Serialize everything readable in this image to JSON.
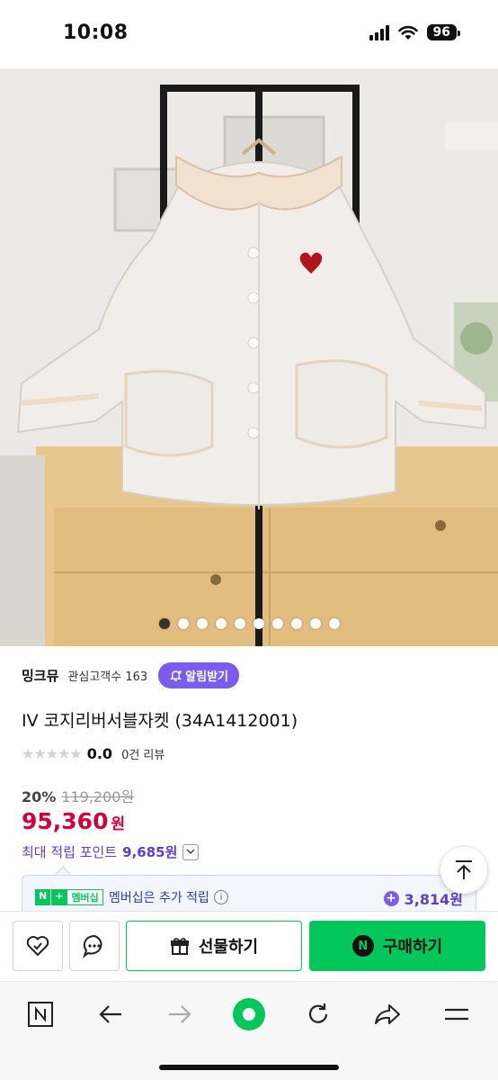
{
  "status_bar": {
    "time": "10:08",
    "battery": "96"
  },
  "gallery": {
    "dots": [
      true,
      false,
      false,
      false,
      false,
      false,
      false,
      false,
      false,
      false
    ]
  },
  "store": {
    "name": "밍크뮤",
    "fans": "관심고객수 163",
    "alert_label": "알림받기",
    "alert_icon": "bell-plus-icon"
  },
  "product": {
    "title": "IV 코지리버서블자켓 (34A1412001)",
    "stars": "★★★★★",
    "rating": "0.0",
    "reviews": "0건 리뷰",
    "discount_rate": "20%",
    "original_price": "119,200원",
    "sale_price": "95,360",
    "sale_unit": "원",
    "points_label": "최대 적립 포인트",
    "points_value": "9,685원"
  },
  "membership": {
    "badge_n": "N",
    "badge_plus": "+",
    "badge_label": "멤버십",
    "text": "멤버십은 추가 적립",
    "info_icon": "i",
    "points": "3,814원"
  },
  "actions": {
    "gift_label": "선물하기",
    "buy_label": "구매하기",
    "buy_icon": "N"
  },
  "colors": {
    "accent_green": "#03c75a",
    "accent_purple": "#7b5cf0",
    "price_red": "#d2003b"
  }
}
